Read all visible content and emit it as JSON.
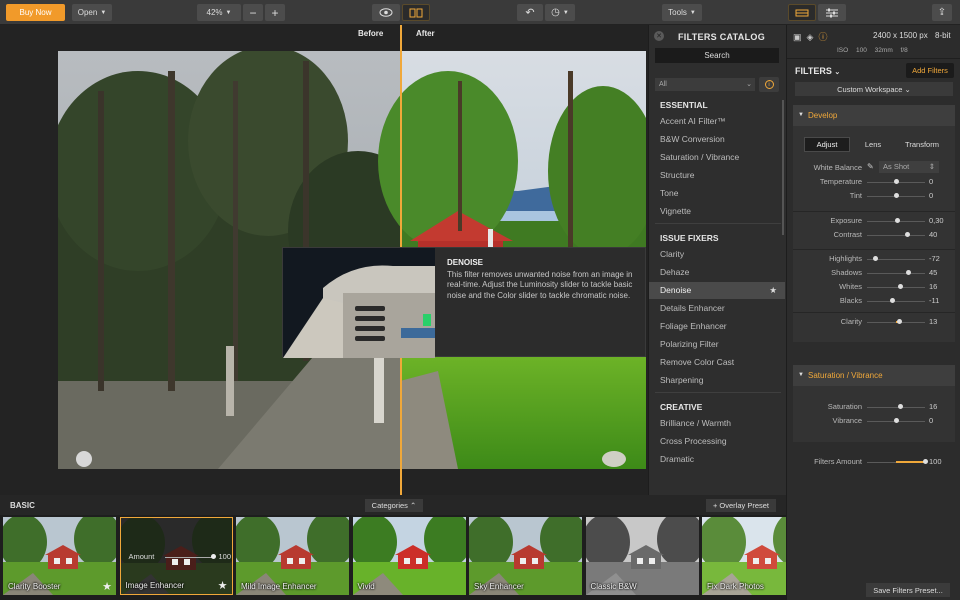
{
  "toolbar": {
    "buy_now": "Buy Now",
    "open": "Open",
    "zoom": "42%",
    "minus": "−",
    "plus": "+",
    "tools": "Tools"
  },
  "canvas": {
    "before_label": "Before",
    "after_label": "After"
  },
  "tooltip": {
    "title": "DENOISE",
    "text": "This filter removes unwanted noise from an image in real-time. Adjust the Luminosity slider to tackle basic noise and the Color slider to tackle chromatic noise."
  },
  "catalog": {
    "title": "FILTERS CATALOG",
    "search": "Search",
    "filter_select": "All",
    "sections": [
      {
        "title": "ESSENTIAL",
        "items": [
          "Accent AI Filter™",
          "B&W Conversion",
          "Saturation / Vibrance",
          "Structure",
          "Tone",
          "Vignette"
        ]
      },
      {
        "title": "ISSUE FIXERS",
        "items": [
          "Clarity",
          "Dehaze",
          "Denoise",
          "Details Enhancer",
          "Foliage Enhancer",
          "Polarizing Filter",
          "Remove Color Cast",
          "Sharpening"
        ]
      },
      {
        "title": "CREATIVE",
        "items": [
          "Brilliance / Warmth",
          "Cross Processing",
          "Dramatic"
        ]
      }
    ],
    "active_item": "Denoise"
  },
  "right_panel": {
    "resolution": "2400 x 1500 px",
    "bit_depth": "8-bit",
    "exif": [
      "ISO 100",
      "32mm",
      "f/8"
    ],
    "filters_title": "FILTERS",
    "add_filters": "Add Filters",
    "workspace": "Custom Workspace",
    "develop": {
      "title": "Develop",
      "tabs": [
        "Adjust",
        "Lens",
        "Transform"
      ],
      "active_tab": "Adjust",
      "white_balance_label": "White Balance",
      "white_balance_value": "As Shot",
      "sliders": [
        {
          "label": "Temperature",
          "value": "0",
          "pos": 0.5
        },
        {
          "label": "Tint",
          "value": "0",
          "pos": 0.5
        },
        {
          "label": "Exposure",
          "value": "0,30",
          "pos": 0.52
        },
        {
          "label": "Contrast",
          "value": "40",
          "pos": 0.7
        },
        {
          "label": "Highlights",
          "value": "-72",
          "pos": 0.14
        },
        {
          "label": "Shadows",
          "value": "45",
          "pos": 0.72
        },
        {
          "label": "Whites",
          "value": "16",
          "pos": 0.58
        },
        {
          "label": "Blacks",
          "value": "-11",
          "pos": 0.44
        },
        {
          "label": "Clarity",
          "value": "13",
          "pos": 0.56
        }
      ]
    },
    "saturation": {
      "title": "Saturation / Vibrance",
      "sliders": [
        {
          "label": "Saturation",
          "value": "16",
          "pos": 0.58
        },
        {
          "label": "Vibrance",
          "value": "0",
          "pos": 0.5
        }
      ]
    },
    "filters_amount": {
      "label": "Filters Amount",
      "value": "100",
      "pos": 1.0
    },
    "save_preset": "Save Filters Preset..."
  },
  "bottom": {
    "basic": "BASIC",
    "categories": "Categories",
    "overlay_preset": "+ Overlay Preset",
    "amount_label": "Amount",
    "amount_value": "100",
    "presets": [
      {
        "name": "Clarity Booster",
        "star": true,
        "style": "normal"
      },
      {
        "name": "Image Enhancer",
        "star": true,
        "style": "dark",
        "selected": true
      },
      {
        "name": "Mild Image Enhancer",
        "star": false,
        "style": "normal"
      },
      {
        "name": "Vivid",
        "star": false,
        "style": "vivid"
      },
      {
        "name": "Sky Enhancer",
        "star": false,
        "style": "normal"
      },
      {
        "name": "Classic B&W",
        "star": false,
        "style": "bw"
      },
      {
        "name": "Fix Dark Photos",
        "star": false,
        "style": "bright"
      }
    ]
  },
  "colors": {
    "accent": "#f0a83a",
    "buy_button": "#f19a2a"
  }
}
